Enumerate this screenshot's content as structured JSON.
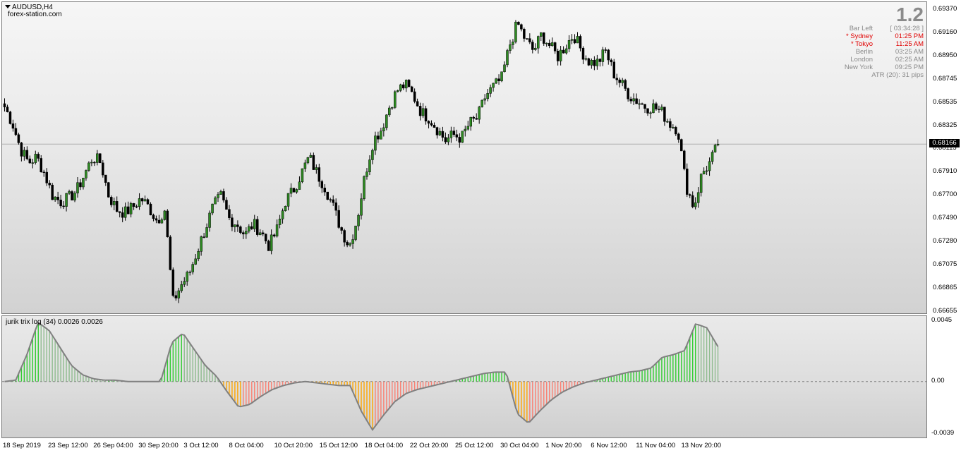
{
  "chart": {
    "symbol_title": "AUDUSD,H4",
    "source": "forex-station.com",
    "current_price": "0.68166",
    "big_number": "1.2",
    "info_panel": [
      {
        "label": "Bar Left",
        "value": "[ 03:34:28 ]",
        "highlight": false
      },
      {
        "label": "* Sydney",
        "value": "01:25 PM",
        "highlight": true
      },
      {
        "label": "* Tokyo",
        "value": "11:25 AM",
        "highlight": true
      },
      {
        "label": "Berlin",
        "value": "03:25 AM",
        "highlight": false
      },
      {
        "label": "London",
        "value": "02:25 AM",
        "highlight": false
      },
      {
        "label": "New York",
        "value": "09:25 PM",
        "highlight": false
      }
    ],
    "atr_text": "ATR (20): 31 pips",
    "price_ticks": [
      "0.69370",
      "0.69160",
      "0.68950",
      "0.68745",
      "0.68535",
      "0.68325",
      "0.68115",
      "0.67910",
      "0.67700",
      "0.67490",
      "0.67280",
      "0.67075",
      "0.66865",
      "0.66655"
    ],
    "indicator_title": "jurik trix log (34) 0.0026 0.0026",
    "indicator_ticks": [
      "0.0045",
      "0.00",
      "-0.0039"
    ],
    "time_ticks": [
      "18 Sep 2019",
      "23 Sep 12:00",
      "26 Sep 04:00",
      "30 Sep 20:00",
      "3 Oct 12:00",
      "8 Oct 04:00",
      "10 Oct 20:00",
      "15 Oct 12:00",
      "18 Oct 04:00",
      "22 Oct 20:00",
      "25 Oct 12:00",
      "30 Oct 04:00",
      "1 Nov 20:00",
      "6 Nov 12:00",
      "11 Nov 04:00",
      "13 Nov 20:00"
    ],
    "colors": {
      "bull": "#2e8b22",
      "bear": "#000000",
      "hist_up_strong": "#32cd32",
      "hist_up_weak": "#8fbc8f",
      "hist_down_strong": "#ffa500",
      "hist_down_weak": "#fa8072",
      "signal_line": "#808080"
    }
  },
  "chart_data": [
    {
      "type": "candlestick",
      "title": "AUDUSD,H4",
      "ylim": [
        0.66655,
        0.6937
      ],
      "x_labels": [
        "18 Sep 2019",
        "23 Sep 12:00",
        "26 Sep 04:00",
        "30 Sep 20:00",
        "3 Oct 12:00",
        "8 Oct 04:00",
        "10 Oct 20:00",
        "15 Oct 12:00",
        "18 Oct 04:00",
        "22 Oct 20:00",
        "25 Oct 12:00",
        "30 Oct 04:00",
        "1 Nov 20:00",
        "6 Nov 12:00",
        "11 Nov 04:00",
        "13 Nov 20:00"
      ],
      "close_path": [
        0.685,
        0.6835,
        0.6812,
        0.68,
        0.6805,
        0.679,
        0.677,
        0.6765,
        0.6768,
        0.6775,
        0.679,
        0.6805,
        0.68,
        0.677,
        0.6758,
        0.6755,
        0.676,
        0.6768,
        0.676,
        0.6748,
        0.6758,
        0.6675,
        0.669,
        0.67,
        0.672,
        0.674,
        0.676,
        0.677,
        0.675,
        0.6745,
        0.6735,
        0.6745,
        0.6738,
        0.6725,
        0.674,
        0.6765,
        0.6775,
        0.679,
        0.6805,
        0.679,
        0.6778,
        0.676,
        0.674,
        0.6725,
        0.675,
        0.679,
        0.682,
        0.683,
        0.685,
        0.6865,
        0.687,
        0.686,
        0.6845,
        0.684,
        0.683,
        0.682,
        0.6825,
        0.6822,
        0.6835,
        0.684,
        0.686,
        0.6868,
        0.6875,
        0.6905,
        0.6925,
        0.691,
        0.69,
        0.6915,
        0.6905,
        0.6895,
        0.6905,
        0.6915,
        0.69,
        0.689,
        0.689,
        0.69,
        0.688,
        0.687,
        0.686,
        0.6855,
        0.685,
        0.685,
        0.6845,
        0.6835,
        0.683,
        0.678,
        0.676,
        0.679,
        0.68,
        0.6816
      ],
      "current": 0.68166,
      "ylabel": ""
    },
    {
      "type": "histogram",
      "title": "jurik trix log (34) 0.0026 0.0026",
      "ylim": [
        -0.0039,
        0.0045
      ],
      "values": [
        0.0,
        0.0001,
        0.002,
        0.0044,
        0.0038,
        0.0025,
        0.0012,
        0.0005,
        0.0002,
        0.0001,
        0.0001,
        0.0,
        0.0,
        0.0,
        0.0,
        0.0029,
        0.0036,
        0.0024,
        0.0012,
        0.0004,
        -0.0008,
        -0.0019,
        -0.0017,
        -0.0011,
        -0.0006,
        -0.0003,
        -0.0001,
        0.0,
        -0.0001,
        -0.0002,
        -0.0003,
        -0.0003,
        -0.0022,
        -0.0036,
        -0.0025,
        -0.0015,
        -0.0009,
        -0.0006,
        -0.0004,
        -0.0002,
        0.0,
        0.0002,
        0.0004,
        0.0006,
        0.0007,
        0.0007,
        -0.0024,
        -0.0031,
        -0.0022,
        -0.0014,
        -0.0008,
        -0.0004,
        -0.0001,
        0.0001,
        0.0003,
        0.0005,
        0.0007,
        0.0008,
        0.001,
        0.0018,
        0.002,
        0.0023,
        0.0043,
        0.004,
        0.0026
      ]
    }
  ]
}
